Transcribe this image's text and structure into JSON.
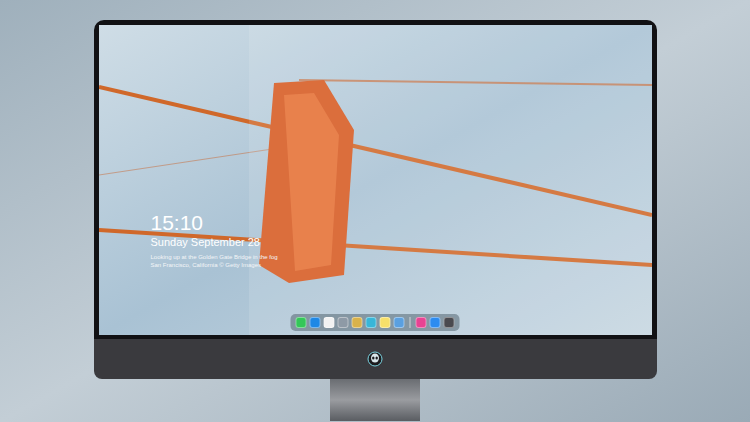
{
  "lock_screen": {
    "time": "15:10",
    "date": "Sunday September 28",
    "caption": [
      "Looking up at the Golden Gate Bridge in the fog",
      "San Francisco, California © Getty Images"
    ]
  },
  "dock": {
    "items": [
      {
        "kind": "app",
        "color": "#34c759"
      },
      {
        "kind": "app",
        "color": "#1e88e5"
      },
      {
        "kind": "app",
        "color": "#f2f2f2"
      },
      {
        "kind": "app",
        "color": "#8e9aa6"
      },
      {
        "kind": "app",
        "color": "#d9b24a"
      },
      {
        "kind": "app",
        "color": "#38b6d8"
      },
      {
        "kind": "app",
        "color": "#f7e06a"
      },
      {
        "kind": "app",
        "color": "#5aa0e0"
      },
      {
        "kind": "separator"
      },
      {
        "kind": "app",
        "color": "#e84393"
      },
      {
        "kind": "app",
        "color": "#2d8cf0"
      },
      {
        "kind": "app",
        "color": "#4a4a4f"
      }
    ]
  }
}
